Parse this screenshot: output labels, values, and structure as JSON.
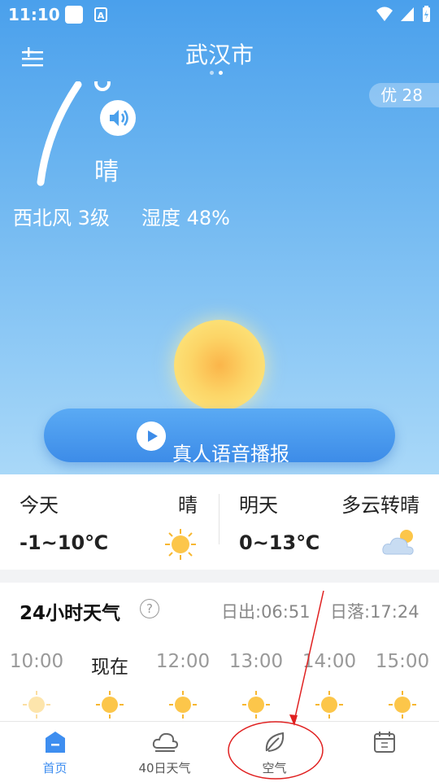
{
  "status": {
    "time": "11:10",
    "sim_label": "A"
  },
  "header": {
    "city": "武汉市",
    "aqi": "优 28"
  },
  "current": {
    "condition": "晴",
    "wind": "西北风 3级",
    "humidity": "湿度 48%"
  },
  "voice": {
    "label": "真人语音播报"
  },
  "forecast": {
    "today": {
      "day": "今天",
      "condition": "晴",
      "temp": "-1~10℃",
      "icon": "sun-icon"
    },
    "tomorrow": {
      "day": "明天",
      "condition": "多云转晴",
      "temp": "0~13℃",
      "icon": "cloud-sun-icon"
    }
  },
  "hourly": {
    "title": "24小时天气",
    "sunrise": "日出:06:51",
    "sunset": "日落:17:24",
    "hours": [
      "10:00",
      "现在",
      "12:00",
      "13:00",
      "14:00",
      "15:00"
    ]
  },
  "tabs": [
    {
      "label": "首页",
      "icon": "home-icon"
    },
    {
      "label": "40日天气",
      "icon": "cloud-icon"
    },
    {
      "label": "空气",
      "icon": "leaf-icon"
    },
    {
      "label": "",
      "icon": "calendar-icon"
    }
  ],
  "colors": {
    "accent": "#3e8ef0",
    "sky_top": "#4aa0ec",
    "annotation": "#e02020"
  }
}
